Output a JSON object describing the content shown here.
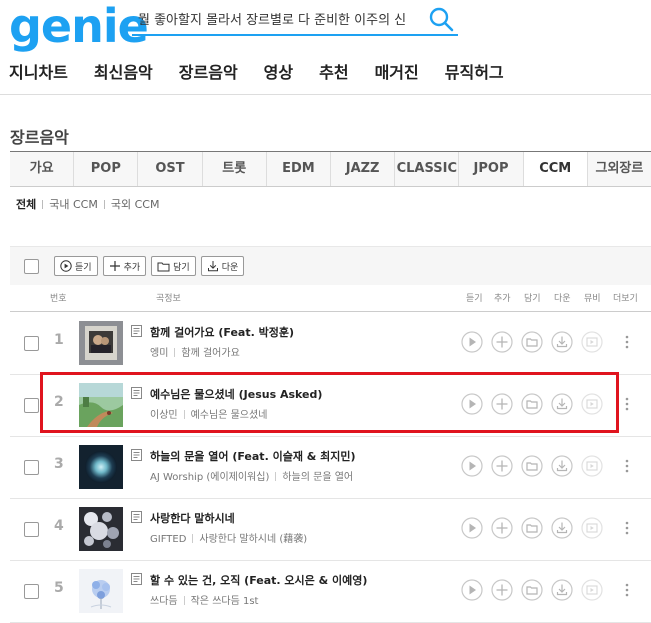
{
  "logo": "genie",
  "search": {
    "value": "뭘 좋아할지 몰라서 장르별로 다 준비한 이주의 신"
  },
  "gnb": [
    "지니차트",
    "최신음악",
    "장르음악",
    "영상",
    "추천",
    "매거진",
    "뮤직허그"
  ],
  "section_title": "장르음악",
  "genre_tabs": [
    "가요",
    "POP",
    "OST",
    "트롯",
    "EDM",
    "JAZZ",
    "CLASSIC",
    "JPOP",
    "CCM",
    "그외장르"
  ],
  "active_genre": "CCM",
  "subfilters": [
    "전체",
    "국내 CCM",
    "국외 CCM"
  ],
  "toolbar": {
    "listen": "듣기",
    "add": "추가",
    "save": "담기",
    "download": "다운"
  },
  "list_header": {
    "number": "번호",
    "info": "곡정보",
    "listen": "듣기",
    "add": "추가",
    "save": "담기",
    "download": "다운",
    "movie": "뮤비",
    "more": "더보기"
  },
  "songs": [
    {
      "rank": "1",
      "title": "함께 걸어가요 (Feat. 박정훈)",
      "artist": "엥미",
      "album": "함께 걸어가요"
    },
    {
      "rank": "2",
      "title": "예수님은 물으셨네 (Jesus Asked)",
      "artist": "이상민",
      "album": "예수님은 물으셨네"
    },
    {
      "rank": "3",
      "title": "하늘의 문을 열어 (Feat. 이슬재 & 최지민)",
      "artist": "AJ Worship (에이제이워십)",
      "album": "하늘의 문을 열어"
    },
    {
      "rank": "4",
      "title": "사랑한다 말하시네",
      "artist": "GIFTED",
      "album": "사랑한다 말하시네 (藉袭)"
    },
    {
      "rank": "5",
      "title": "할 수 있는 건, 오직 (Feat. 오시은 & 이예영)",
      "artist": "쓰다듬",
      "album": "작은 쓰다듬 1st"
    }
  ],
  "colors": {
    "brand": "#1da1f2",
    "highlight": "#e0141e"
  }
}
